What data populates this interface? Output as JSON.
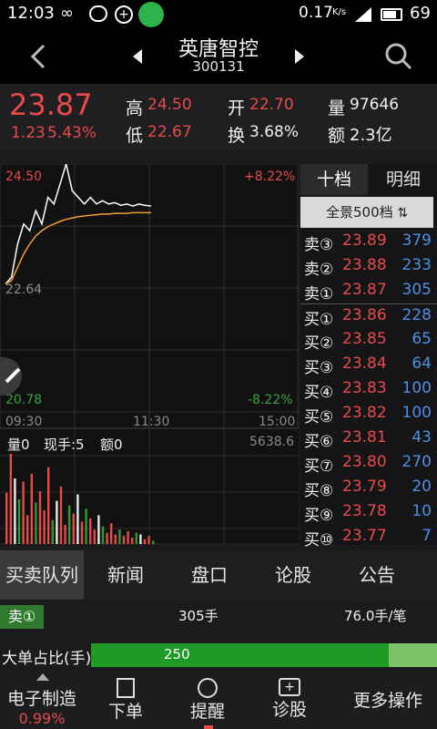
{
  "status": {
    "time": "12:03",
    "net_speed": "0.17",
    "speed_unit": "K/s",
    "battery": "69"
  },
  "header": {
    "name": "英唐智控",
    "code": "300131"
  },
  "quote": {
    "price": "23.87",
    "change": "1.23",
    "change_pct": "5.43%",
    "high_label": "高",
    "high": "24.50",
    "open_label": "开",
    "open": "22.70",
    "volume_label": "量",
    "volume": "97646",
    "low_label": "低",
    "low": "22.67",
    "turnover_label": "换",
    "turnover": "3.68%",
    "amount_label": "额",
    "amount": "2.3亿"
  },
  "chart": {
    "price_top": "24.50",
    "price_mid": "22.64",
    "price_bottom": "20.78",
    "pct_top": "+8.22%",
    "pct_bottom": "-8.22%",
    "time_start": "09:30",
    "time_mid": "11:30",
    "time_end": "15:00",
    "vol_info": {
      "vol": "量0",
      "now": "现手:5",
      "amt": "额0"
    },
    "vol_max": "5638.6"
  },
  "chart_data": {
    "type": "line",
    "ylim": [
      20.78,
      24.5
    ],
    "series": [
      {
        "values": [
          22.7,
          22.8,
          23.3,
          23.6,
          23.5,
          23.8,
          23.6,
          24.0,
          23.9,
          24.2,
          24.5,
          24.1,
          24.0,
          23.9,
          24.0,
          23.9,
          23.95,
          23.9,
          23.92,
          23.88,
          23.9,
          23.87,
          23.9,
          23.88,
          23.87
        ]
      },
      {
        "values": [
          22.7,
          22.75,
          22.95,
          23.15,
          23.3,
          23.42,
          23.5,
          23.56,
          23.6,
          23.64,
          23.67,
          23.69,
          23.71,
          23.72,
          23.73,
          23.74,
          23.75,
          23.75,
          23.76,
          23.76,
          23.76,
          23.77,
          23.77,
          23.77,
          23.77
        ]
      }
    ],
    "volumes": [
      3200,
      5638,
      4100,
      2800,
      3900,
      1800,
      4400,
      2600,
      3300,
      2100,
      4800,
      1500,
      2700,
      3600,
      1200,
      2400,
      1900,
      3100,
      1400,
      2200,
      1600,
      900,
      1800,
      1100,
      700,
      1300,
      600,
      900,
      500,
      800,
      400,
      700,
      600,
      300,
      500,
      200
    ]
  },
  "orderbook": {
    "tab_ten": "十档",
    "tab_detail": "明细",
    "promo": "全景500档",
    "rows": [
      {
        "label": "卖③",
        "price": "23.89",
        "qty": "379"
      },
      {
        "label": "卖②",
        "price": "23.88",
        "qty": "233"
      },
      {
        "label": "卖①",
        "price": "23.87",
        "qty": "305"
      },
      {
        "label": "买①",
        "price": "23.86",
        "qty": "228"
      },
      {
        "label": "买②",
        "price": "23.85",
        "qty": "65"
      },
      {
        "label": "买③",
        "price": "23.84",
        "qty": "64"
      },
      {
        "label": "买④",
        "price": "23.83",
        "qty": "100"
      },
      {
        "label": "买⑤",
        "price": "23.82",
        "qty": "100"
      },
      {
        "label": "买⑥",
        "price": "23.81",
        "qty": "43"
      },
      {
        "label": "买⑦",
        "price": "23.80",
        "qty": "270"
      },
      {
        "label": "买⑧",
        "price": "23.79",
        "qty": "20"
      },
      {
        "label": "买⑨",
        "price": "23.78",
        "qty": "10"
      },
      {
        "label": "买⑩",
        "price": "23.77",
        "qty": "7"
      }
    ]
  },
  "tabs": [
    "买卖队列",
    "新闻",
    "盘口",
    "论股",
    "公告"
  ],
  "queue": {
    "label": "卖①",
    "lots": "305手",
    "per": "76.0手/笔"
  },
  "bigorder": {
    "label": "大单占比(手)",
    "value": "250",
    "fill_fraction": 0.86
  },
  "nav": {
    "sector": "电子制造",
    "sector_pct": "0.99%",
    "order": "下单",
    "alert": "提醒",
    "diagnose": "诊股",
    "more": "更多操作"
  },
  "colors": {
    "red": "#e84a4a",
    "green": "#3fa03f",
    "blue": "#4f8fe0",
    "bar_green": "#2f9a2f"
  }
}
